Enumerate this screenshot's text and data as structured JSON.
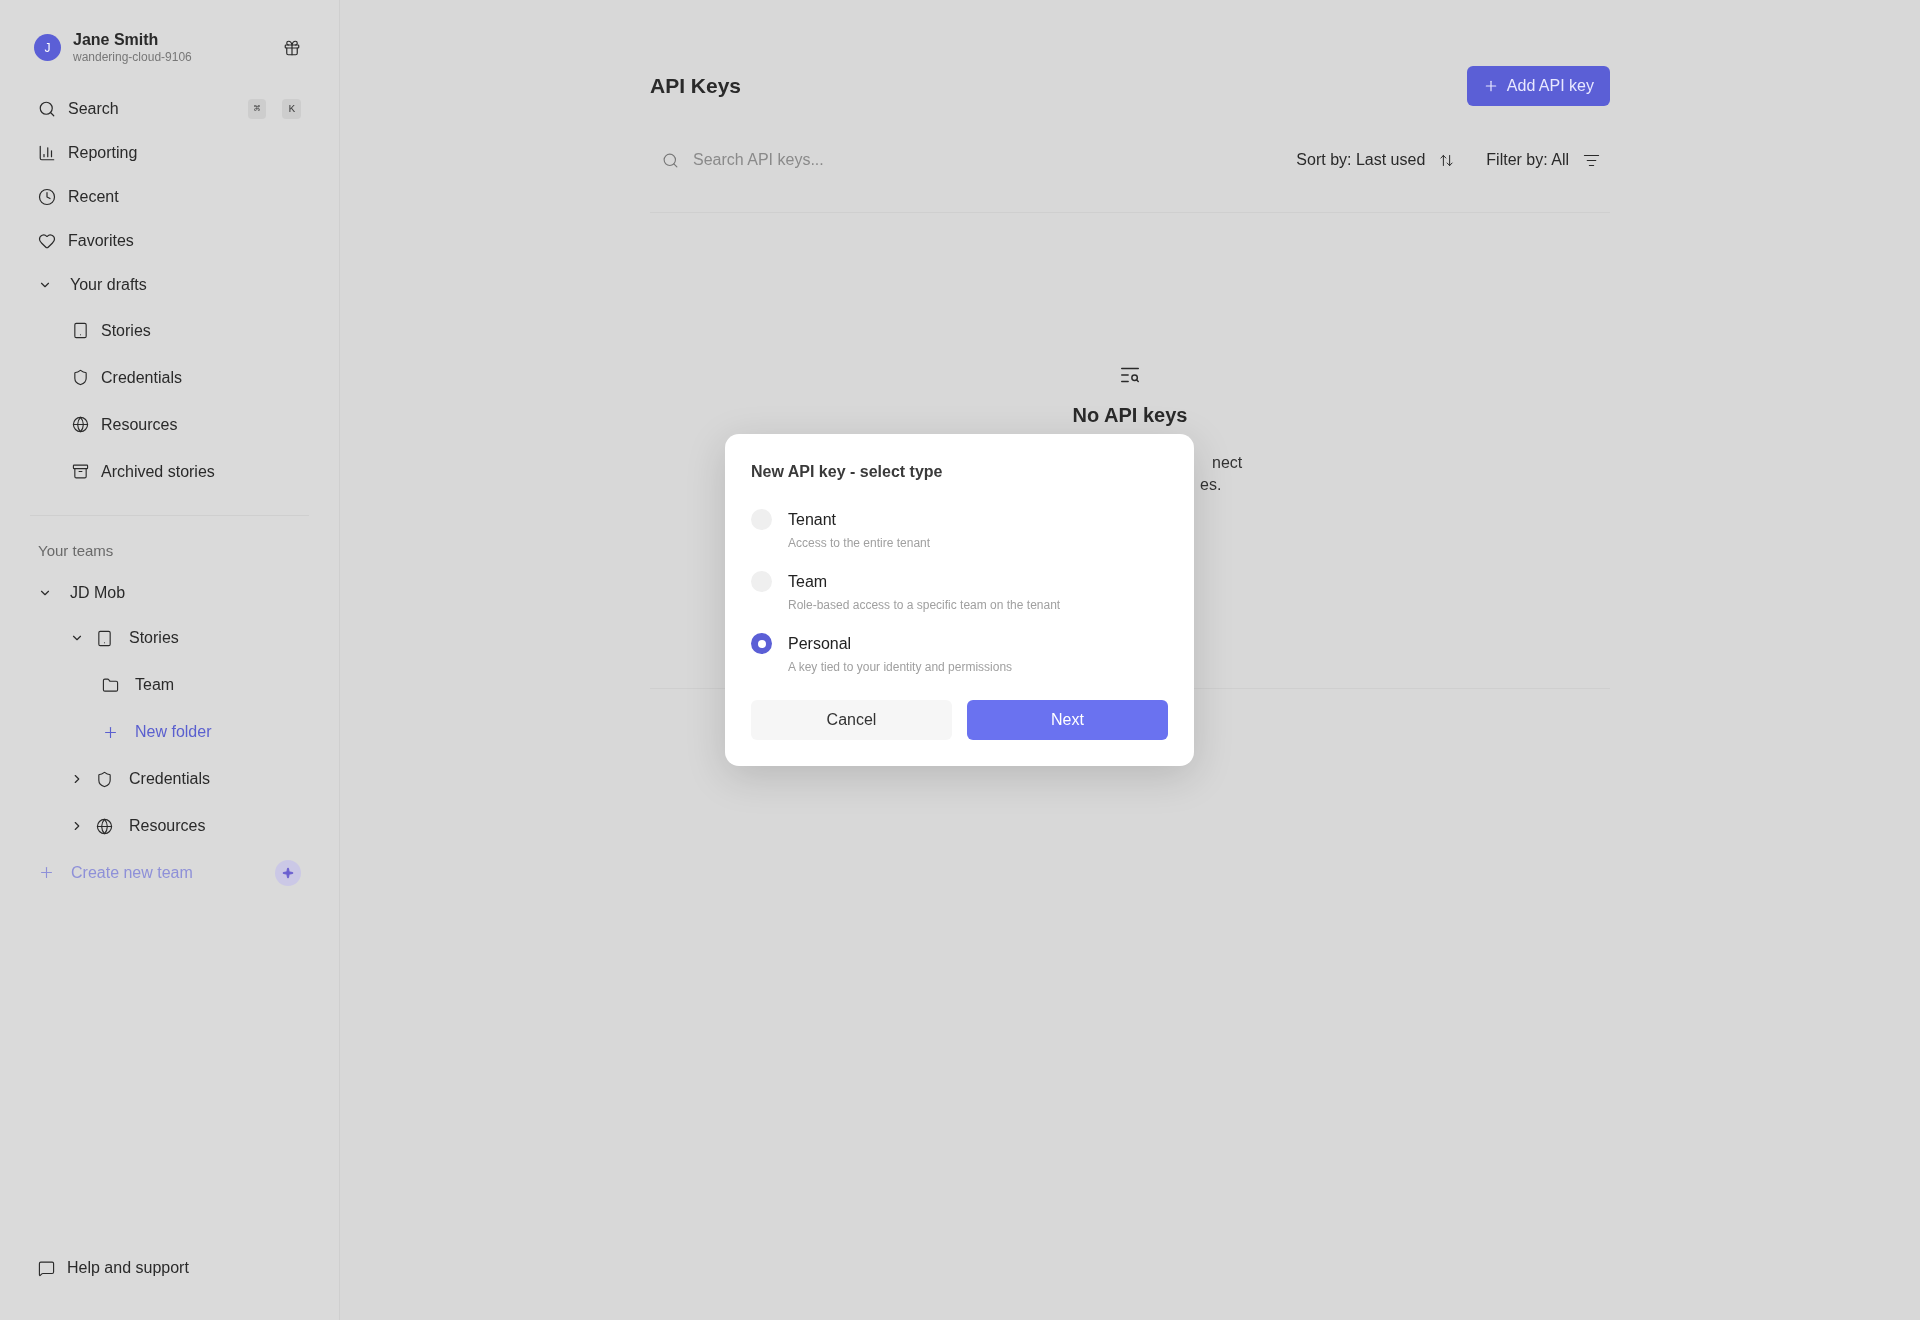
{
  "user": {
    "initial": "J",
    "name": "Jane Smith",
    "handle": "wandering-cloud-9106"
  },
  "nav": [
    {
      "kind": "search",
      "label": "Search",
      "keys": [
        "⌘",
        "K"
      ]
    },
    {
      "kind": "reporting",
      "label": "Reporting"
    },
    {
      "kind": "recent",
      "label": "Recent"
    },
    {
      "kind": "favorites",
      "label": "Favorites"
    }
  ],
  "drafts": {
    "label": "Your drafts",
    "expanded": true,
    "children": [
      {
        "kind": "stories",
        "label": "Stories"
      },
      {
        "kind": "credentials",
        "label": "Credentials"
      },
      {
        "kind": "resources",
        "label": "Resources"
      },
      {
        "kind": "archive",
        "label": "Archived stories"
      }
    ]
  },
  "teams": {
    "heading": "Your teams",
    "items": [
      {
        "label": "JD Mob",
        "expanded": true,
        "children": [
          {
            "kind": "stories",
            "label": "Stories",
            "expanded": true,
            "children": [
              {
                "kind": "folder",
                "label": "Team"
              },
              {
                "kind": "new",
                "label": "New folder"
              }
            ]
          },
          {
            "kind": "credentials",
            "label": "Credentials",
            "expanded": false
          },
          {
            "kind": "resources",
            "label": "Resources",
            "expanded": false
          }
        ]
      }
    ],
    "create": "Create new team"
  },
  "help": "Help and support",
  "page": {
    "title": "API Keys",
    "add_button": "Add API key",
    "search": {
      "placeholder": "Search API keys..."
    },
    "sort": "Sort by: Last used",
    "filter": "Filter by: All"
  },
  "empty": {
    "heading": "No API keys",
    "fragments": [
      "nect",
      "es."
    ]
  },
  "dialog": {
    "title": "New API key - select type",
    "options": [
      {
        "label": "Tenant",
        "description": "Access to the entire tenant",
        "selected": false
      },
      {
        "label": "Team",
        "description": "Role-based access to a specific team on the tenant",
        "selected": false
      },
      {
        "label": "Personal",
        "description": "A key tied to your identity and permissions",
        "selected": true
      }
    ],
    "cancel": "Cancel",
    "next": "Next"
  }
}
